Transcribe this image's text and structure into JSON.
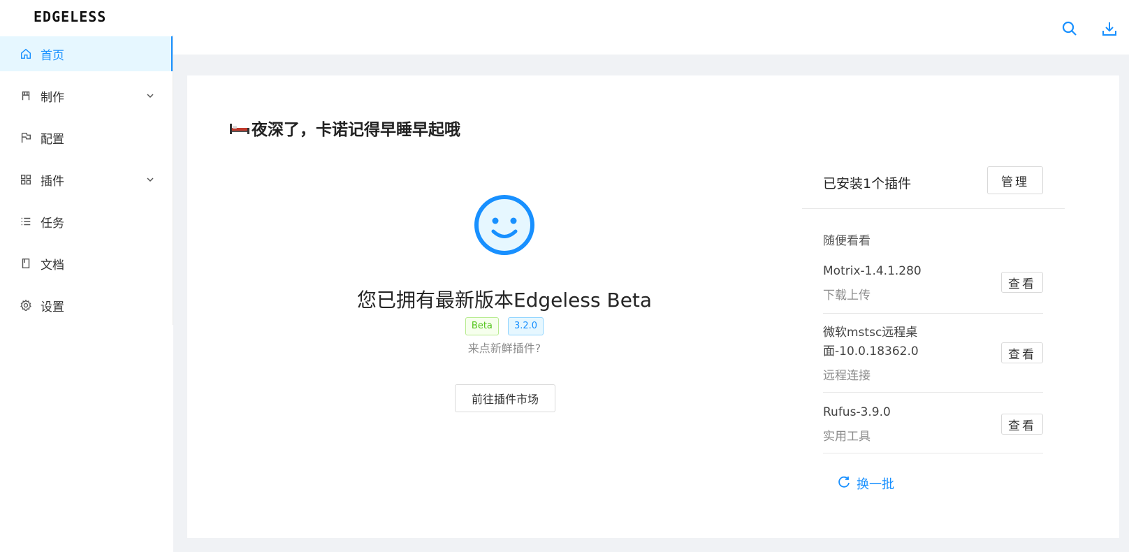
{
  "app": {
    "logo": "EDGELESS"
  },
  "sidebar": {
    "items": [
      {
        "label": "首页",
        "icon": "home-icon",
        "active": true
      },
      {
        "label": "制作",
        "icon": "build-icon",
        "expandable": true
      },
      {
        "label": "配置",
        "icon": "flag-icon"
      },
      {
        "label": "插件",
        "icon": "appstore-icon",
        "expandable": true
      },
      {
        "label": "任务",
        "icon": "list-icon"
      },
      {
        "label": "文档",
        "icon": "book-icon"
      },
      {
        "label": "设置",
        "icon": "gear-icon"
      }
    ]
  },
  "header": {
    "actions": [
      "search-icon",
      "download-icon"
    ]
  },
  "main": {
    "greeting": "夜深了，卡诺记得早睡早起哦",
    "result": {
      "title": "您已拥有最新版本Edgeless Beta",
      "tags": [
        "Beta",
        "3.2.0"
      ],
      "subtitle": "来点新鲜插件?",
      "button": "前往插件市场"
    }
  },
  "plugins_panel": {
    "installed_title": "已安装1个插件",
    "manage_label": "管理",
    "browse_title": "随便看看",
    "items": [
      {
        "name": "Motrix-1.4.1.280",
        "category": "下载上传",
        "view_label": "查看"
      },
      {
        "name": "微软mstsc远程桌面-10.0.18362.0",
        "category": "远程连接",
        "view_label": "查看"
      },
      {
        "name": "Rufus-3.9.0",
        "category": "实用工具",
        "view_label": "查看"
      }
    ],
    "refresh_label": "换一批"
  },
  "colors": {
    "accent": "#1890ff",
    "active_bg": "#e6f7ff",
    "beta_tag": "#52c41a"
  }
}
